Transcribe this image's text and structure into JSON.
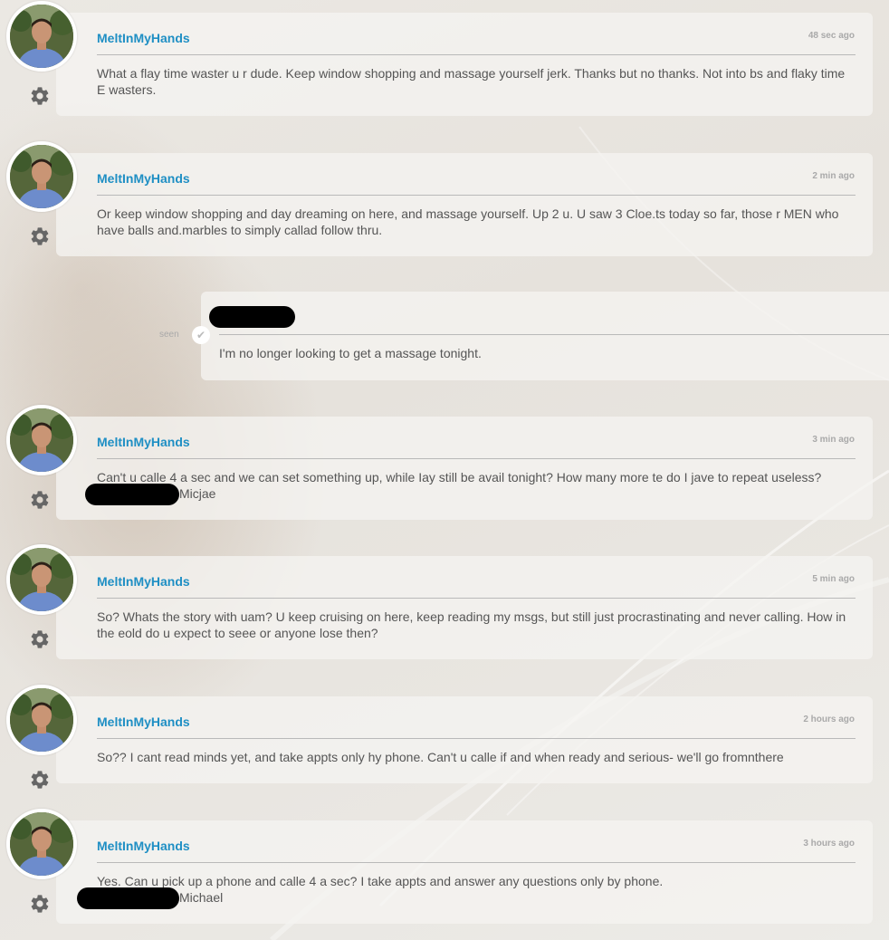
{
  "conversation": {
    "messages": [
      {
        "sender": "MeltInMyHands",
        "time": "48 sec ago",
        "text": "What a flay time waster u r dude. Keep window shopping and massage yourself jerk. Thanks but no thanks. Not into bs and flaky time E wasters."
      },
      {
        "sender": "MeltInMyHands",
        "time": "2 min ago",
        "text": "Or keep window shopping and day dreaming on here, and massage yourself. Up 2 u. U saw 3 Cloe.ts today so far, those r MEN who have balls and.marbles to simply callad follow thru."
      },
      {
        "sender": "MeltInMyHands",
        "time": "3 min ago",
        "text": "Can't u calle 4 a sec and we can set something up, while Iay still be avail tonight? How many more te do I jave to repeat useless?",
        "signature": "Micjae"
      },
      {
        "sender": "MeltInMyHands",
        "time": "5 min ago",
        "text": "So? Whats the story with uam? U keep cruising on here, keep reading my msgs, but still just procrastinating and never calling. How in the eold do u expect to seee or anyone lose then?"
      },
      {
        "sender": "MeltInMyHands",
        "time": "2 hours ago",
        "text": "So?? I cant read minds yet, and take appts only hy phone. Can't u calle if and when ready and serious- we'll go fromnthere"
      },
      {
        "sender": "MeltInMyHands",
        "time": "3 hours ago",
        "text": "Yes. Can u pick up a phone and calle 4 a sec? I take appts and answer any questions only by phone.",
        "signature": "Michael"
      }
    ],
    "reply": {
      "status": "seen",
      "text": "I'm no longer looking to get a massage tonight."
    }
  },
  "icons": {
    "settings": "gear-icon",
    "read_receipt": "checkmark-icon"
  },
  "colors": {
    "username": "#1f8fc4",
    "timestamp": "#a9a9a9",
    "body_text": "#555555"
  }
}
